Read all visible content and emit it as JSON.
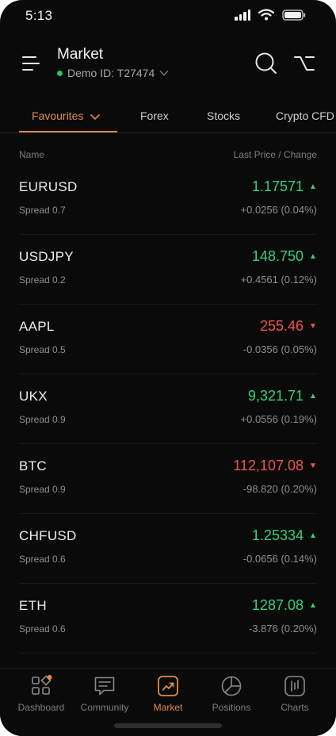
{
  "status_bar": {
    "time": "5:13"
  },
  "header": {
    "title": "Market",
    "account_label": "Demo ID: T27474"
  },
  "tabs": [
    {
      "label": "Favourites",
      "active": true
    },
    {
      "label": "Forex"
    },
    {
      "label": "Stocks"
    },
    {
      "label": "Crypto CFD"
    }
  ],
  "list_header": {
    "left": "Name",
    "right": "Last Price / Change"
  },
  "instruments": [
    {
      "symbol": "EURUSD",
      "spread": "Spread 0.7",
      "price": "1.17571",
      "direction": "up",
      "change": "+0.0256 (0.04%)"
    },
    {
      "symbol": "USDJPY",
      "spread": "Spread 0.2",
      "price": "148.750",
      "direction": "up",
      "change": "+0.4561 (0.12%)"
    },
    {
      "symbol": "AAPL",
      "spread": "Spread 0.5",
      "price": "255.46",
      "direction": "down",
      "change": "-0.0356 (0.05%)"
    },
    {
      "symbol": "UKX",
      "spread": "Spread 0.9",
      "price": "9,321.71",
      "direction": "up",
      "change": "+0.0556 (0.19%)"
    },
    {
      "symbol": "BTC",
      "spread": "Spread 0.9",
      "price": "112,107.08",
      "direction": "down",
      "change": "-98.820 (0.20%)"
    },
    {
      "symbol": "CHFUSD",
      "spread": "Spread 0.6",
      "price": "1.25334",
      "direction": "up",
      "change": "-0.0656 (0.14%)"
    },
    {
      "symbol": "ETH",
      "spread": "Spread 0.6",
      "price": "1287.08",
      "direction": "up",
      "change": "-3.876 (0.20%)"
    }
  ],
  "arrows": {
    "up": "▲",
    "down": "▼"
  },
  "bottom_nav": [
    {
      "label": "Dashboard",
      "icon": "dashboard-icon"
    },
    {
      "label": "Community",
      "icon": "chat-icon"
    },
    {
      "label": "Market",
      "icon": "trend-icon",
      "active": true
    },
    {
      "label": "Positions",
      "icon": "pie-chart-icon"
    },
    {
      "label": "Charts",
      "icon": "candles-icon"
    }
  ],
  "colors": {
    "accent": "#e08a4e",
    "up": "#34d17a",
    "down": "#ef5350",
    "background": "#0a0a0a"
  }
}
